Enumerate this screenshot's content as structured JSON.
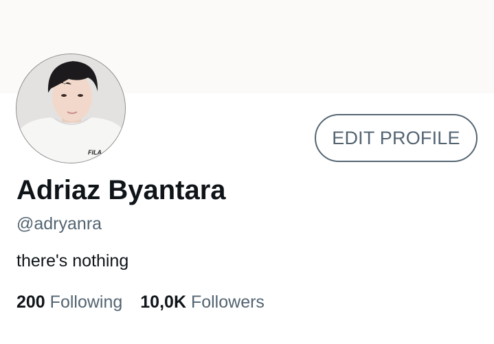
{
  "profile": {
    "display_name": "Adriaz Byantara",
    "handle": "@adryanra",
    "bio": "there's nothing",
    "edit_button_label": "EDIT PROFILE",
    "avatar_icon": "person-photo-icon",
    "avatar_shirt_text": "FILA"
  },
  "stats": {
    "following_count": "200",
    "following_label": "Following",
    "followers_count": "10,0K",
    "followers_label": "Followers"
  },
  "colors": {
    "primary_text": "#0f1419",
    "secondary_text": "#536471",
    "banner": "#fbfaf9",
    "button_border": "#536471"
  }
}
